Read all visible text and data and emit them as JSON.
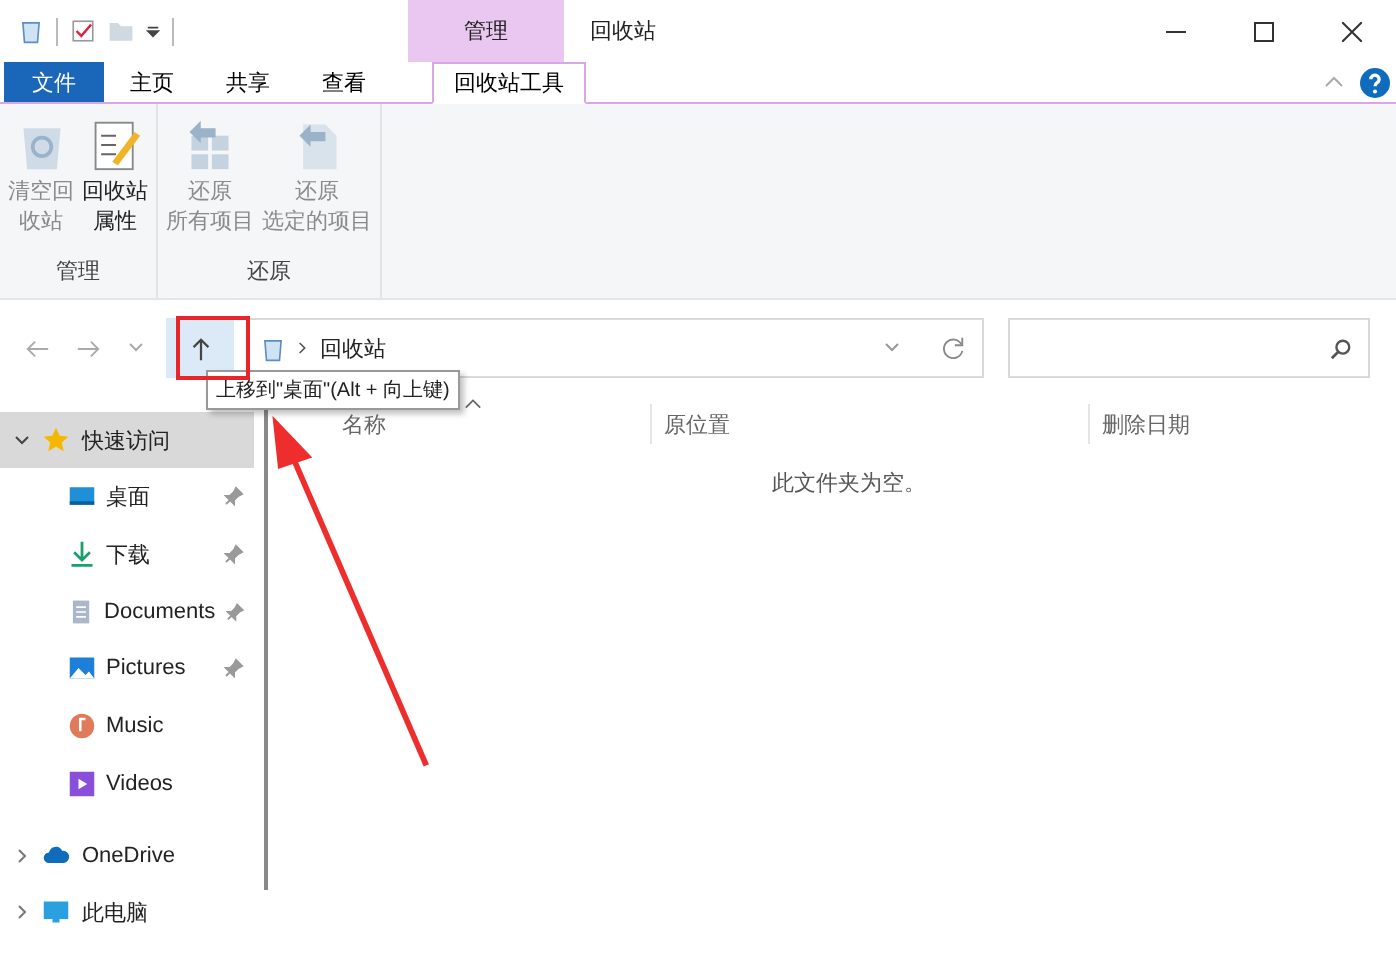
{
  "window": {
    "title": "回收站",
    "context_tab": "管理"
  },
  "ribbon_tabs": [
    {
      "label": "文件",
      "kind": "file",
      "selected": false
    },
    {
      "label": "主页",
      "kind": "tab",
      "selected": false
    },
    {
      "label": "共享",
      "kind": "tab",
      "selected": false
    },
    {
      "label": "查看",
      "kind": "tab",
      "selected": false
    },
    {
      "label": "回收站工具",
      "kind": "tab",
      "selected": true
    }
  ],
  "ribbon_groups": [
    {
      "label": "管理",
      "buttons": [
        {
          "lines": [
            "清空回",
            "收站"
          ],
          "kind": "empty",
          "disabled": true
        },
        {
          "lines": [
            "回收站",
            "属性"
          ],
          "kind": "properties",
          "disabled": false
        }
      ]
    },
    {
      "label": "还原",
      "buttons": [
        {
          "lines": [
            "还原",
            "所有项目"
          ],
          "kind": "restore-all",
          "disabled": true
        },
        {
          "lines": [
            "还原",
            "选定的项目"
          ],
          "kind": "restore-selected",
          "disabled": true
        }
      ]
    }
  ],
  "address": {
    "path": [
      "回收站"
    ]
  },
  "tooltip": "上移到\"桌面\"(Alt + 向上键)",
  "columns": [
    {
      "label": "名称",
      "sorted": true
    },
    {
      "label": "原位置",
      "sorted": false
    },
    {
      "label": "删除日期",
      "sorted": false
    }
  ],
  "empty_message": "此文件夹为空。",
  "sidebar": [
    {
      "label": "快速访问",
      "kind": "quick-access",
      "expanded": true,
      "selected": true,
      "children": [
        {
          "label": "桌面",
          "kind": "desktop",
          "pinned": true,
          "selected": false
        },
        {
          "label": "下载",
          "kind": "downloads",
          "pinned": true,
          "selected": false
        },
        {
          "label": "Documents",
          "kind": "documents",
          "pinned": true,
          "selected": false
        },
        {
          "label": "Pictures",
          "kind": "pictures",
          "pinned": true,
          "selected": false
        },
        {
          "label": "Music",
          "kind": "music",
          "pinned": false,
          "selected": false
        },
        {
          "label": "Videos",
          "kind": "videos",
          "pinned": false,
          "selected": false
        }
      ]
    },
    {
      "label": "OneDrive",
      "kind": "cloud",
      "expanded": false,
      "selected": false
    },
    {
      "label": "此电脑",
      "kind": "computer",
      "expanded": false,
      "selected": false
    }
  ]
}
